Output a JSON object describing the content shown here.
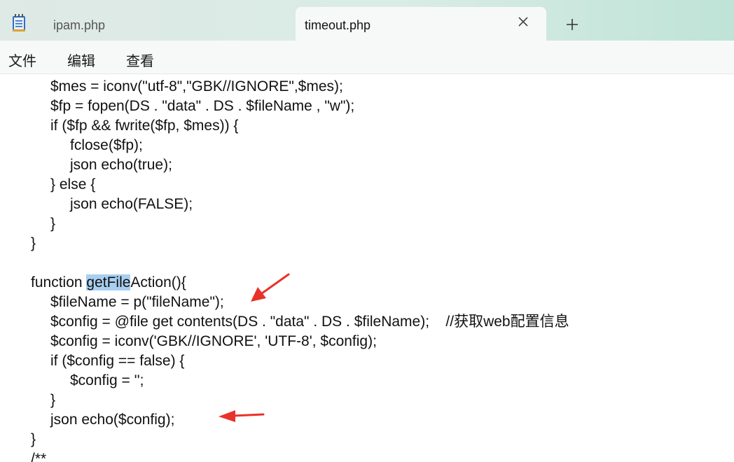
{
  "tabs": [
    {
      "label": "ipam.php",
      "active": false
    },
    {
      "label": "timeout.php",
      "active": true
    }
  ],
  "menu": [
    "文件",
    "编辑",
    "查看"
  ],
  "icons": {
    "app": "notepad-icon",
    "close": "close-icon",
    "new_tab": "plus-icon",
    "annotation": "red-arrow-icon"
  },
  "colors": {
    "selection_highlight": "#a9cff0",
    "annotation_arrow": "#e8322a"
  },
  "code": {
    "lines": [
      {
        "indent": 2,
        "text": "$mes = iconv(\"utf-8\",\"GBK//IGNORE\",$mes);"
      },
      {
        "indent": 2,
        "text": "$fp = fopen(DS . \"data\" . DS . $fileName , \"w\");"
      },
      {
        "indent": 2,
        "text": "if ($fp && fwrite($fp, $mes)) {"
      },
      {
        "indent": 3,
        "text": "fclose($fp);"
      },
      {
        "indent": 3,
        "text": "json echo(true);"
      },
      {
        "indent": 2,
        "text": "} else {"
      },
      {
        "indent": 3,
        "text": "json echo(FALSE);"
      },
      {
        "indent": 2,
        "text": "}"
      },
      {
        "indent": 1,
        "text": "}"
      },
      {
        "indent": 0,
        "text": ""
      },
      {
        "indent": 1,
        "pre": "function ",
        "highlight": "getFile",
        "post": "Action(){"
      },
      {
        "indent": 2,
        "text": "$fileName = p(\"fileName\");"
      },
      {
        "indent": 2,
        "text": "$config = @file get contents(DS . \"data\" . DS . $fileName);    //获取web配置信息"
      },
      {
        "indent": 2,
        "text": "$config = iconv('GBK//IGNORE', 'UTF-8', $config);"
      },
      {
        "indent": 2,
        "text": "if ($config == false) {"
      },
      {
        "indent": 3,
        "text": "$config = '';"
      },
      {
        "indent": 2,
        "text": "}"
      },
      {
        "indent": 2,
        "text": "json echo($config);"
      },
      {
        "indent": 1,
        "text": "}"
      },
      {
        "indent": 1,
        "text": "/**"
      }
    ]
  }
}
